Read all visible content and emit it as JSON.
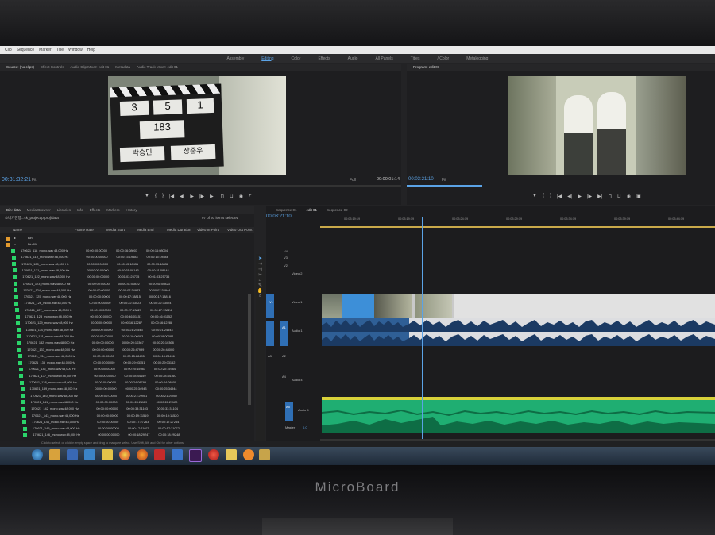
{
  "menu": {
    "items": [
      "Clip",
      "Sequence",
      "Marker",
      "Title",
      "Window",
      "Help"
    ]
  },
  "workspaces": {
    "items": [
      "Assembly",
      "Editing",
      "Color",
      "Effects",
      "Audio",
      "All Panels",
      "Titles",
      "/ Color",
      "Metalogging"
    ],
    "active": "Editing"
  },
  "source_monitor": {
    "tabs": [
      "Source: (no clips)",
      "Effect Controls",
      "Audio Clip Mixer: edit 01",
      "Metadata",
      "Audio Track Mixer: edit 01"
    ],
    "timecode": "00:31:32:21",
    "fit": "Fit",
    "quality": "Full",
    "duration": "00:00:01:14",
    "slate": [
      "3",
      "5",
      "1",
      "183",
      "박승민",
      "장준우"
    ]
  },
  "program_monitor": {
    "tab": "Program: edit 01",
    "timecode": "00:03:21:10",
    "fit": "Fit"
  },
  "bin": {
    "title": "Bin: data",
    "tabs": [
      "Media Browser",
      "Libraries",
      "Info",
      "Effects",
      "Markers",
      "History"
    ],
    "path": "소나기진행...ck_project.prproj\\data",
    "count": "97 of 91 items selected",
    "columns": [
      "Name",
      "Frame Rate",
      "Media Start",
      "Media End",
      "Media Duration",
      "Video In Point",
      "Video Out Point"
    ],
    "folders": [
      "Bin",
      "Bin 01"
    ],
    "rows": [
      {
        "name": "170621_118_mono.wav",
        "rate": "48,000 Hz",
        "start": "00:00:00:00000",
        "end": "00:00:16:08003",
        "dur": "00:00:16:08004"
      },
      {
        "name": "170621_119_mono.wav",
        "rate": "48,000 Hz",
        "start": "00:00:00:00000",
        "end": "00:00:15:19583",
        "dur": "00:00:15:19584"
      },
      {
        "name": "170621_120_mono.wav",
        "rate": "48,000 Hz",
        "start": "00:00:00:00000",
        "end": "00:00:15:18431",
        "dur": "00:00:15:18432"
      },
      {
        "name": "170621_121_mono.wav",
        "rate": "48,000 Hz",
        "start": "00:00:00:00000",
        "end": "00:00:31:08143",
        "dur": "00:00:31:08144"
      },
      {
        "name": "170621_122_mono.wav",
        "rate": "48,000 Hz",
        "start": "00:00:00:00000",
        "end": "00:01:03:25735",
        "dur": "00:01:03:25736"
      },
      {
        "name": "170621_123_mono.wav",
        "rate": "48,000 Hz",
        "start": "00:00:00:00000",
        "end": "00:00:41:00822",
        "dur": "00:00:41:00823"
      },
      {
        "name": "170621_124_mono.wav",
        "rate": "48,000 Hz",
        "start": "00:00:00:00000",
        "end": "00:00:07:34943",
        "dur": "00:00:07:34944"
      },
      {
        "name": "170621_125_mono.wav",
        "rate": "48,000 Hz",
        "start": "00:00:00:00000",
        "end": "00:00:17:18815",
        "dur": "00:00:17:18816"
      },
      {
        "name": "170621_126_mono.wav",
        "rate": "48,000 Hz",
        "start": "00:00:00:00000",
        "end": "00:00:22:33023",
        "dur": "00:00:22:33024"
      },
      {
        "name": "170621_127_mono.wav",
        "rate": "48,000 Hz",
        "start": "00:00:00:00000",
        "end": "00:00:27:13823",
        "dur": "00:00:27:13824"
      },
      {
        "name": "170621_128_mono.wav",
        "rate": "48,000 Hz",
        "start": "00:00:00:00000",
        "end": "00:00:46:01151",
        "dur": "00:00:46:01152"
      },
      {
        "name": "170621_129_mono.wav",
        "rate": "48,000 Hz",
        "start": "00:00:00:00000",
        "end": "00:00:16:12287",
        "dur": "00:00:16:12288"
      },
      {
        "name": "170621_130_mono.wav",
        "rate": "48,000 Hz",
        "start": "00:00:00:00000",
        "end": "00:00:21:24543",
        "dur": "00:00:21:24544"
      },
      {
        "name": "170621_131_mono.wav",
        "rate": "48,000 Hz",
        "start": "00:00:00:00000",
        "end": "00:00:19:00083",
        "dur": "00:00:19:00084"
      },
      {
        "name": "170621_132_mono.wav",
        "rate": "48,000 Hz",
        "start": "00:00:00:00000",
        "end": "00:00:20:10367",
        "dur": "00:00:20:10368"
      },
      {
        "name": "170621_133_mono.wav",
        "rate": "48,000 Hz",
        "start": "00:00:00:00000",
        "end": "00:00:26:47999",
        "dur": "00:00:26:48000"
      },
      {
        "name": "170621_134_mono.wav",
        "rate": "48,000 Hz",
        "start": "00:00:00:00000",
        "end": "00:00:15:28495",
        "dur": "00:00:15:28496"
      },
      {
        "name": "170621_135_mono.wav",
        "rate": "48,000 Hz",
        "start": "00:00:00:00000",
        "end": "00:00:29:03151",
        "dur": "00:00:29:03152"
      },
      {
        "name": "170621_136_mono.wav",
        "rate": "48,000 Hz",
        "start": "00:00:00:00000",
        "end": "00:00:20:15983",
        "dur": "00:00:20:15984"
      },
      {
        "name": "170621_137_mono.wav",
        "rate": "48,000 Hz",
        "start": "00:00:00:00000",
        "end": "00:00:28:44159",
        "dur": "00:00:28:44160"
      },
      {
        "name": "170621_138_mono.wav",
        "rate": "48,000 Hz",
        "start": "00:00:00:00000",
        "end": "00:00:24:08799",
        "dur": "00:00:24:08800"
      },
      {
        "name": "170621_139_mono.wav",
        "rate": "48,000 Hz",
        "start": "00:00:00:00000",
        "end": "00:00:25:34943",
        "dur": "00:00:25:34944"
      },
      {
        "name": "170621_140_mono.wav",
        "rate": "48,000 Hz",
        "start": "00:00:00:00000",
        "end": "00:00:21:29951",
        "dur": "00:00:21:29952"
      },
      {
        "name": "170621_141_mono.wav",
        "rate": "48,000 Hz",
        "start": "00:00:00:00000",
        "end": "00:00:28:21119",
        "dur": "00:00:28:21120"
      },
      {
        "name": "170621_142_mono.wav",
        "rate": "48,000 Hz",
        "start": "00:00:00:00000",
        "end": "00:00:33:31103",
        "dur": "00:00:33:31104"
      },
      {
        "name": "170621_143_mono.wav",
        "rate": "48,000 Hz",
        "start": "00:00:00:00000",
        "end": "00:00:19:11519",
        "dur": "00:00:19:11520"
      },
      {
        "name": "170621_144_mono.wav",
        "rate": "48,000 Hz",
        "start": "00:00:00:00000",
        "end": "00:00:17:27263",
        "dur": "00:00:17:27264"
      },
      {
        "name": "170621_145_mono.wav",
        "rate": "48,000 Hz",
        "start": "00:00:00:00000",
        "end": "00:00:17:21071",
        "dur": "00:00:17:21072"
      },
      {
        "name": "170621_146_mono.wav",
        "rate": "48,000 Hz",
        "start": "00:00:00:00000",
        "end": "00:00:18:29247",
        "dur": "00:00:18:29248"
      }
    ]
  },
  "timeline": {
    "tabs": [
      "Sequence 01",
      "edit 01",
      "Sequence 02"
    ],
    "active_tab": "edit 01",
    "timecode": "00:03:21:10",
    "ruler": [
      "00:03:19:19",
      "00:03:19:19",
      "00:03:24:19",
      "00:03:29:19",
      "00:03:34:19",
      "00:03:39:19",
      "00:03:44:19"
    ],
    "tracks": {
      "video": [
        "V4",
        "V3",
        "V2",
        "V1"
      ],
      "v_label": "Video 1",
      "v2_label": "Video 2",
      "audio": [
        "A1",
        "A2",
        "A3",
        "A4",
        "A5"
      ],
      "a1_label": "Audio 1",
      "a4_label": "Audio 4",
      "a5_label": "Audio 5",
      "master": "Master",
      "master_val": "0.0"
    }
  },
  "hint": "Click to select, or click in empty space and drag to marquee select. Use Shift, Alt, and Ctrl for other options.",
  "brand": "MicroBoard",
  "colors": {
    "accent": "#5ba3e6",
    "clip_green": "#2bd46a",
    "audio_blue": "#2f5f96",
    "audio_green": "#1fae72"
  }
}
